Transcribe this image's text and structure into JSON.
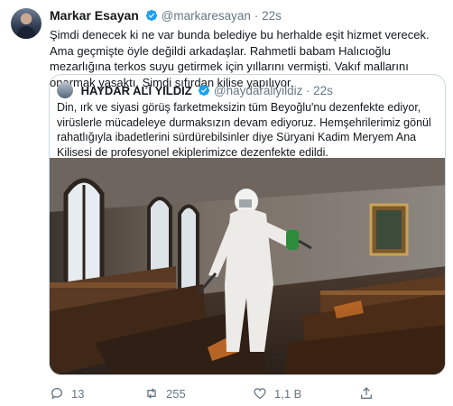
{
  "tweet": {
    "author_name": "Markar Esayan",
    "author_handle": "@markaresayan",
    "separator": "·",
    "time": "22s",
    "text": "Şimdi denecek ki ne var bunda belediye bu herhalde eşit hizmet verecek. Ama geçmişte öyle değildi arkadaşlar. Rahmetli babam Halıcıoğlu mezarlığına terkos suyu getirmek için yıllarını vermişti. Vakıf mallarını onarmak yasaktı. Şimdi sıfırdan kilise yapılıyor."
  },
  "quoted": {
    "author_name": "HAYDAR ALİ YILDIZ",
    "author_handle": "@haydaraliyildiz",
    "separator": "·",
    "time": "22s",
    "text": "Din, ırk ve siyasi görüş farketmeksizin tüm Beyoğlu'nu dezenfekte ediyor, virüslerle mücadeleye durmaksızın devam ediyoruz. Hemşehrilerimiz gönül rahatlığıyla ibadetlerini sürdürebilsinler diye Süryani Kadim Meryem Ana Kilisesi de profesyonel ekiplerimizce dezenfekte edildi."
  },
  "actions": {
    "reply_count": "13",
    "retweet_count": "255",
    "like_count": "1,1 B",
    "share_label": ""
  },
  "icons": [
    "verified-badge-icon",
    "reply-icon",
    "retweet-icon",
    "like-icon",
    "share-icon"
  ],
  "colors": {
    "verified": "#1da1f2",
    "muted": "#657786",
    "border": "#ccd6dd"
  }
}
